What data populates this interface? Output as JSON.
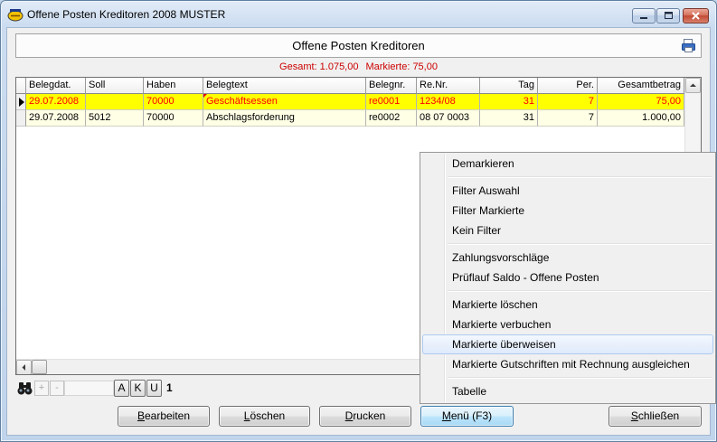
{
  "window": {
    "title": "Offene Posten Kreditoren 2008 MUSTER",
    "icon": "app-logo-icon",
    "caption_buttons": [
      "minimize-icon",
      "maximize-icon",
      "close-icon"
    ]
  },
  "header": {
    "title": "Offene Posten Kreditoren",
    "icon": "print-export-icon"
  },
  "totals": {
    "gesamt": "Gesamt: 1.075,00",
    "markierte": "Markierte: 75,00",
    "color": "#cc0000"
  },
  "grid": {
    "columns": [
      "Belegdat.",
      "Soll",
      "Haben",
      "Belegtext",
      "Belegnr.",
      "Re.Nr.",
      "Tag",
      "Per.",
      "Gesamtbetrag"
    ],
    "rows": [
      {
        "current": true,
        "marked": true,
        "has_note": true,
        "cells": [
          "29.07.2008",
          "",
          "70000",
          "Geschäftsessen",
          "re0001",
          "1234/08",
          "31",
          "7",
          "75,00"
        ]
      },
      {
        "current": false,
        "marked": false,
        "has_note": false,
        "cells": [
          "29.07.2008",
          "5012",
          "70000",
          "Abschlagsforderung",
          "re0002",
          "08 07 0003",
          "31",
          "7",
          "1.000,00"
        ]
      }
    ],
    "colors": {
      "marked_row_bg": "#ffff00",
      "marked_row_text": "#ff0000",
      "row_bg": "#ffffe6",
      "note_marker": "#e00000"
    }
  },
  "navigator": {
    "search_icon": "binoculars-icon",
    "add_label": "+",
    "add_enabled": false,
    "remove_label": "-",
    "remove_enabled": false,
    "search_value": "",
    "letter_buttons": [
      "A",
      "K",
      "U"
    ],
    "record_count": "1"
  },
  "buttons": [
    {
      "label": "Bearbeiten"
    },
    {
      "label": "Löschen"
    },
    {
      "label": "Drucken"
    },
    {
      "label": "Menü (F3)",
      "active": true
    },
    {
      "label": "Schließen"
    }
  ],
  "context_menu": {
    "groups": [
      [
        {
          "label": "Demarkieren"
        }
      ],
      [
        {
          "label": "Filter Auswahl"
        },
        {
          "label": "Filter Markierte"
        },
        {
          "label": "Kein Filter"
        }
      ],
      [
        {
          "label": "Zahlungsvorschläge"
        },
        {
          "label": "Prüflauf Saldo - Offene Posten"
        }
      ],
      [
        {
          "label": "Markierte löschen"
        },
        {
          "label": "Markierte verbuchen"
        },
        {
          "label": "Markierte überweisen",
          "highlighted": true
        },
        {
          "label": "Markierte Gutschriften mit Rechnung ausgleichen"
        }
      ],
      [
        {
          "label": "Tabelle"
        }
      ]
    ]
  }
}
